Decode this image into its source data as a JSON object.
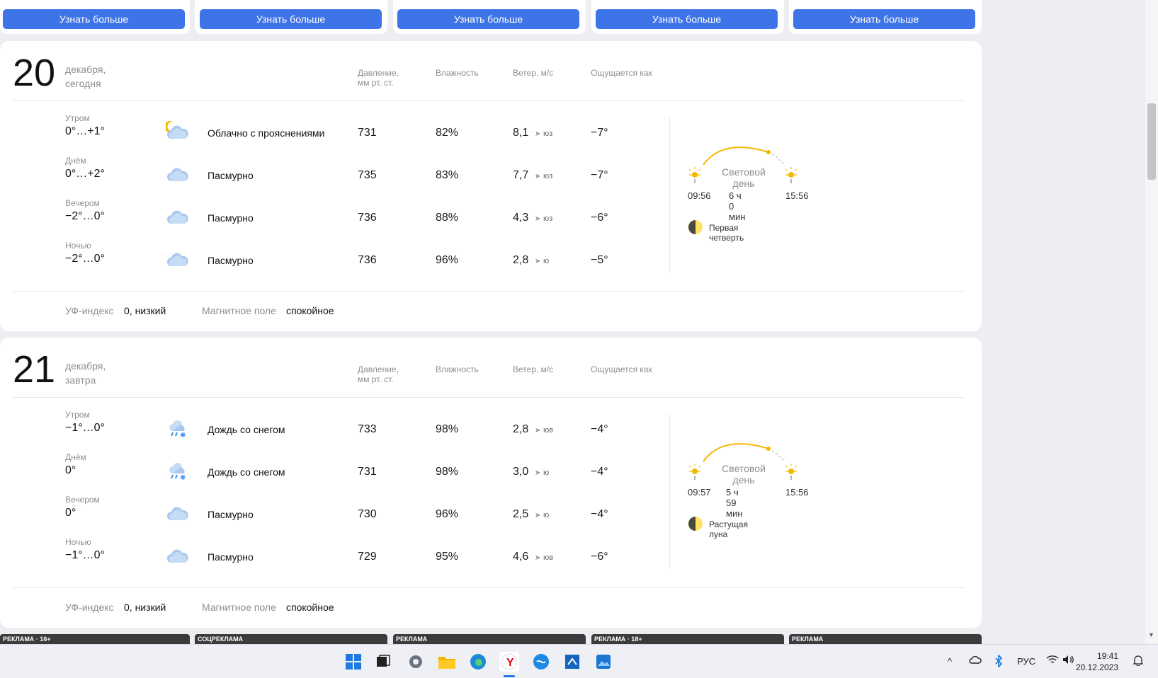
{
  "promo": {
    "button_label": "Узнать больше"
  },
  "days": [
    {
      "day_number": "20",
      "month": "декабря,",
      "relative": "сегодня",
      "headers": {
        "pressure_line1": "Давление,",
        "pressure_line2": "мм рт. ст.",
        "humidity": "Влажность",
        "wind": "Ветер, м/с",
        "feels": "Ощущается как"
      },
      "rows": [
        {
          "part": "Утром",
          "temp": "0°…+1°",
          "icon": "moon-cloud-icon",
          "condition": "Облачно с прояснениями",
          "pressure": "731",
          "humidity": "82%",
          "wind": "8,1",
          "wind_dir": "юз",
          "feels": "−7°"
        },
        {
          "part": "Днём",
          "temp": "0°…+2°",
          "icon": "cloud-icon",
          "condition": "Пасмурно",
          "pressure": "735",
          "humidity": "83%",
          "wind": "7,7",
          "wind_dir": "юз",
          "feels": "−7°"
        },
        {
          "part": "Вечером",
          "temp": "−2°…0°",
          "icon": "cloud-icon",
          "condition": "Пасмурно",
          "pressure": "736",
          "humidity": "88%",
          "wind": "4,3",
          "wind_dir": "юз",
          "feels": "−6°"
        },
        {
          "part": "Ночью",
          "temp": "−2°…0°",
          "icon": "cloud-icon",
          "condition": "Пасмурно",
          "pressure": "736",
          "humidity": "96%",
          "wind": "2,8",
          "wind_dir": "ю",
          "feels": "−5°"
        }
      ],
      "daylight": {
        "label_line1": "Световой",
        "label_line2": "день",
        "sunrise": "09:56",
        "duration": "6 ч 0 мин",
        "sunset": "15:56"
      },
      "moon": "Первая четверть",
      "uv": {
        "label": "УФ-индекс",
        "value": "0, низкий"
      },
      "magnetic": {
        "label": "Магнитное поле",
        "value": "спокойное"
      }
    },
    {
      "day_number": "21",
      "month": "декабря,",
      "relative": "завтра",
      "headers": {
        "pressure_line1": "Давление,",
        "pressure_line2": "мм рт. ст.",
        "humidity": "Влажность",
        "wind": "Ветер, м/с",
        "feels": "Ощущается как"
      },
      "rows": [
        {
          "part": "Утром",
          "temp": "−1°…0°",
          "icon": "sleet-icon",
          "condition": "Дождь со снегом",
          "pressure": "733",
          "humidity": "98%",
          "wind": "2,8",
          "wind_dir": "юв",
          "feels": "−4°"
        },
        {
          "part": "Днём",
          "temp": "0°",
          "icon": "sleet-icon",
          "condition": "Дождь со снегом",
          "pressure": "731",
          "humidity": "98%",
          "wind": "3,0",
          "wind_dir": "ю",
          "feels": "−4°"
        },
        {
          "part": "Вечером",
          "temp": "0°",
          "icon": "cloud-icon",
          "condition": "Пасмурно",
          "pressure": "730",
          "humidity": "96%",
          "wind": "2,5",
          "wind_dir": "ю",
          "feels": "−4°"
        },
        {
          "part": "Ночью",
          "temp": "−1°…0°",
          "icon": "cloud-icon",
          "condition": "Пасмурно",
          "pressure": "729",
          "humidity": "95%",
          "wind": "4,6",
          "wind_dir": "юв",
          "feels": "−6°"
        }
      ],
      "daylight": {
        "label_line1": "Световой",
        "label_line2": "день",
        "sunrise": "09:57",
        "duration": "5 ч 59 мин",
        "sunset": "15:56"
      },
      "moon": "Растущая луна",
      "uv": {
        "label": "УФ-индекс",
        "value": "0, низкий"
      },
      "magnetic": {
        "label": "Магнитное поле",
        "value": "спокойное"
      }
    }
  ],
  "ads": [
    "РЕКЛАМА · 16+",
    "СОЦРЕКЛАМА",
    "РЕКЛАМА",
    "РЕКЛАМА · 18+",
    "РЕКЛАМА"
  ],
  "taskbar": {
    "lang": "РУС",
    "time": "19:41",
    "date": "20.12.2023"
  },
  "colors": {
    "accent": "#3f74e8",
    "sun": "#f5b800"
  }
}
